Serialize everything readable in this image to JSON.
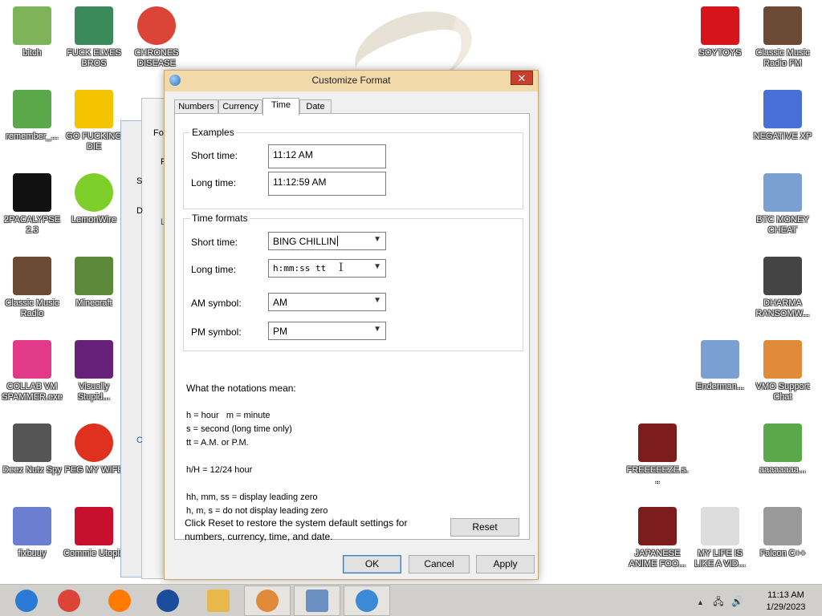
{
  "desktop": {
    "icons": [
      {
        "label": "bitch",
        "icon": "folder-icon",
        "color": "#7fb35a"
      },
      {
        "label": "FUCK ELVES BROS",
        "icon": "elf-image-icon",
        "color": "#3b8a5a"
      },
      {
        "label": "CHRONES DISEASE",
        "icon": "chrome-icon",
        "color": "#db4437"
      },
      {
        "label": "SOYTOYS",
        "icon": "red-s-logo-icon",
        "color": "#d6141c"
      },
      {
        "label": "Classic Music Radio FM",
        "icon": "portrait-icon",
        "color": "#6b4a36"
      },
      {
        "label": "remember_...",
        "icon": "green-file-icon",
        "color": "#5aa84a"
      },
      {
        "label": "GO FUCKING DIE",
        "icon": "de-logo-icon",
        "color": "#f5c400"
      },
      {
        "label": "NEGATIVE XP",
        "icon": "bunny-icon",
        "color": "#4a6fd6"
      },
      {
        "label": "2PACALYPSE 2.3",
        "icon": "cmd-icon",
        "color": "#111111"
      },
      {
        "label": "LemonWire",
        "icon": "lemonwire-icon",
        "color": "#7fcf2a"
      },
      {
        "label": "BTC MONEY CHEAT",
        "icon": "blue-diamond-icon",
        "color": "#7a9fd0"
      },
      {
        "label": "Classic Music Radio",
        "icon": "portrait-icon",
        "color": "#6b4a36"
      },
      {
        "label": "Minecraft",
        "icon": "minecraft-block-icon",
        "color": "#5b8a3a"
      },
      {
        "label": "DHARMA RANSOMW...",
        "icon": "skull-icon",
        "color": "#444444"
      },
      {
        "label": "COLLAB VM SPAMMER.exe",
        "icon": "pink-monitor-icon",
        "color": "#e23a8a"
      },
      {
        "label": "Visually Stupid...",
        "icon": "visual-studio-icon",
        "color": "#68217a"
      },
      {
        "label": "Enderman...",
        "icon": "blue-diamond-icon",
        "color": "#7a9fd0"
      },
      {
        "label": "VMO Support Chat",
        "icon": "doctor-icon",
        "color": "#e08a3a"
      },
      {
        "label": "Deez Nutz Spy",
        "icon": "windows-stack-icon",
        "color": "#555555"
      },
      {
        "label": "PEG MY WIFE",
        "icon": "p-logo-icon",
        "color": "#e0301e"
      },
      {
        "label": "FREEEEEZE.s...",
        "icon": "flash-icon",
        "color": "#7d1c1c"
      },
      {
        "label": "aaaaaaaa...",
        "icon": "green-file-icon",
        "color": "#5aa84a"
      },
      {
        "label": "fixbuuy",
        "icon": "script-file-icon",
        "color": "#6b7fd0"
      },
      {
        "label": "Commie Utopia",
        "icon": "commie-logo-icon",
        "color": "#c8102e"
      },
      {
        "label": "JAPANESE ANIME FOO...",
        "icon": "flash-icon",
        "color": "#7d1c1c"
      },
      {
        "label": "MY LIFE IS LIKE A VID...",
        "icon": "gamepad-icon",
        "color": "#dddddd"
      },
      {
        "label": "Falcon C++",
        "icon": "trash-bin-icon",
        "color": "#999999"
      }
    ],
    "bg_window_fragments": [
      "Fo",
      "F",
      "S",
      "D",
      "L",
      "C"
    ]
  },
  "dialog": {
    "title": "Customize Format",
    "close_glyph": "✕",
    "tabs": [
      "Numbers",
      "Currency",
      "Time",
      "Date"
    ],
    "active_tab": "Time",
    "examples": {
      "group_label": "Examples",
      "short_label": "Short time:",
      "short_value": "11:12 AM",
      "long_label": "Long time:",
      "long_value": "11:12:59 AM"
    },
    "formats": {
      "group_label": "Time formats",
      "short_label": "Short time:",
      "short_value": "BING CHILLIN",
      "long_label": "Long time:",
      "long_value": "h:mm:ss tt",
      "am_label": "AM symbol:",
      "am_value": "AM",
      "pm_label": "PM symbol:",
      "pm_value": "PM"
    },
    "notations": {
      "heading": "What the notations mean:",
      "lines": [
        "h = hour   m = minute",
        "s = second (long time only)",
        "tt = A.M. or P.M.",
        "h/H = 12/24 hour",
        "hh, mm, ss = display leading zero",
        "h, m, s = do not display leading zero"
      ]
    },
    "reset_text": "Click Reset to restore the system default settings for numbers, currency, time, and date.",
    "buttons": {
      "reset": "Reset",
      "ok": "OK",
      "cancel": "Cancel",
      "apply": "Apply"
    }
  },
  "taskbar": {
    "apps": [
      {
        "icon": "chrome-colorful-icon",
        "color": "#2b7bd6"
      },
      {
        "icon": "chrome-icon",
        "color": "#db4437"
      },
      {
        "icon": "firefox-icon",
        "color": "#ff7a00"
      },
      {
        "icon": "obama-logo-icon",
        "color": "#1a4d9c"
      },
      {
        "icon": "file-explorer-icon",
        "color": "#e8b84a"
      },
      {
        "icon": "doctor-icon",
        "color": "#e08a3a"
      },
      {
        "icon": "control-panel-icon",
        "color": "#6c8fc2"
      },
      {
        "icon": "region-globe-icon",
        "color": "#3a8ad6"
      }
    ],
    "tray": {
      "chevron": "▲",
      "network_glyph": "🖧",
      "volume_glyph": "🔊",
      "time": "11:13 AM",
      "date": "1/29/2023"
    }
  }
}
